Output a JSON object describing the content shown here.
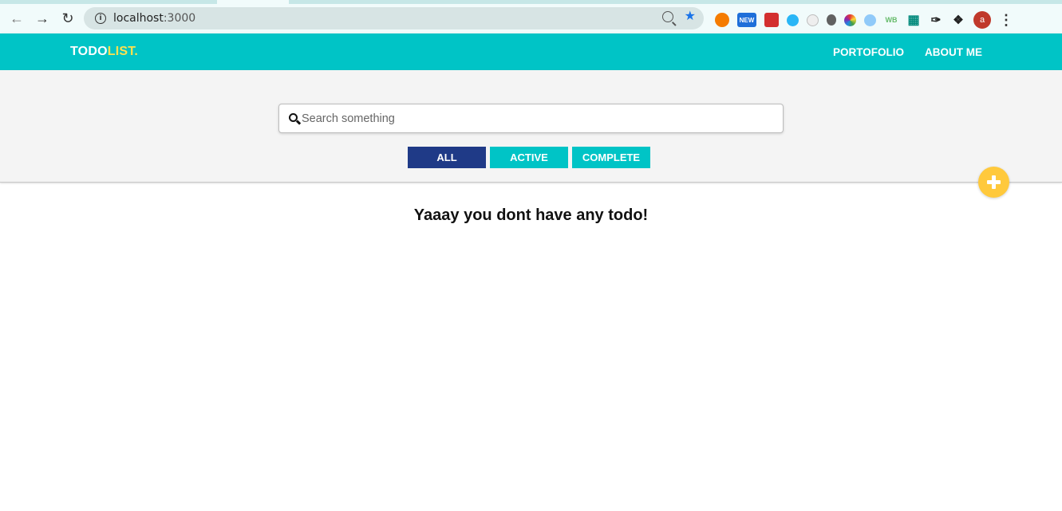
{
  "browser": {
    "url_host": "localhost",
    "url_port": ":3000",
    "extensions": [
      {
        "name": "mango-ext",
        "color": "#f57c00",
        "label": ""
      },
      {
        "name": "new-ext",
        "color": "#1e6fd9",
        "label": "NEW"
      },
      {
        "name": "red-square-ext",
        "color": "#d32f2f",
        "label": ""
      },
      {
        "name": "blue-circle-ext",
        "color": "#29b6f6",
        "label": ""
      },
      {
        "name": "clock-ext",
        "color": "#bdbdbd",
        "label": ""
      },
      {
        "name": "bug-ext",
        "color": "#616161",
        "label": ""
      },
      {
        "name": "color-picker-ext",
        "color": "#8e24aa",
        "label": ""
      },
      {
        "name": "compass-ext",
        "color": "#1565c0",
        "label": ""
      },
      {
        "name": "wb-ext",
        "color": "#66bb6a",
        "label": "WB"
      },
      {
        "name": "crop-ext",
        "color": "#00897b",
        "label": ""
      },
      {
        "name": "brush-ext",
        "color": "#212121",
        "label": ""
      },
      {
        "name": "puzzle-ext",
        "color": "#212121",
        "label": ""
      }
    ],
    "avatar_letter": "a"
  },
  "header": {
    "logo_main": "TODO",
    "logo_accent": "LIST.",
    "nav": [
      {
        "label": "PORTOFOLIO"
      },
      {
        "label": "ABOUT ME"
      }
    ]
  },
  "search": {
    "placeholder": "Search something",
    "value": ""
  },
  "filters": [
    {
      "label": "ALL",
      "selected": true
    },
    {
      "label": "ACTIVE",
      "selected": false
    },
    {
      "label": "COMPLETE",
      "selected": false
    }
  ],
  "main": {
    "empty_message": "Yaaay you dont have any todo!"
  },
  "colors": {
    "primary": "#00c4c6",
    "selected_filter": "#1f3a87",
    "logo_accent": "#ffe14f",
    "fab": "#ffc93c"
  }
}
